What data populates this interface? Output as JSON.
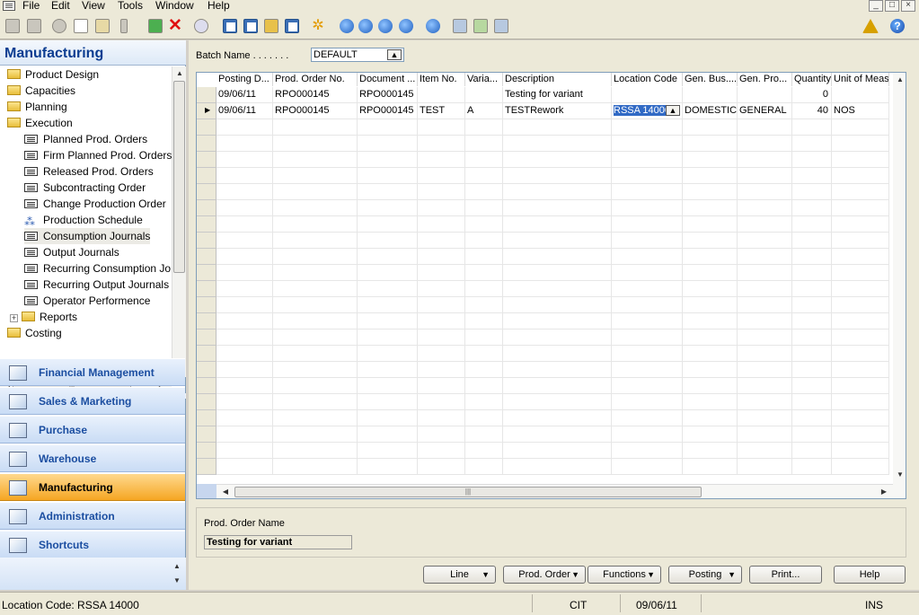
{
  "menu": [
    "File",
    "Edit",
    "View",
    "Tools",
    "Window",
    "Help"
  ],
  "window_controls": [
    "_",
    "□",
    "×"
  ],
  "toolbar_icons": [
    "print-icon",
    "print-preview-icon",
    "cut-icon",
    "copy-icon",
    "paste-icon",
    "attach-icon",
    "delete-icon",
    "find-icon",
    "filter-icon",
    "field-filter-icon",
    "clear-filter-icon",
    "sort-icon",
    "list-icon",
    "flowfield-icon",
    "refresh-icon",
    "first-icon",
    "previous-icon",
    "next-icon",
    "last-icon",
    "up-icon",
    "send-email-icon",
    "export-icon",
    "import-icon",
    "chart-icon",
    "help-icon"
  ],
  "navigation": {
    "title": "Manufacturing",
    "tree": [
      {
        "label": "Product Design",
        "type": "folder",
        "level": 0
      },
      {
        "label": "Capacities",
        "type": "folder",
        "level": 0
      },
      {
        "label": "Planning",
        "type": "folder",
        "level": 0
      },
      {
        "label": "Execution",
        "type": "folder",
        "level": 0
      },
      {
        "label": "Planned Prod. Orders",
        "type": "form",
        "level": 1
      },
      {
        "label": "Firm Planned Prod. Orders",
        "type": "form",
        "level": 1
      },
      {
        "label": "Released Prod. Orders",
        "type": "form",
        "level": 1
      },
      {
        "label": "Subcontracting Order",
        "type": "form",
        "level": 1
      },
      {
        "label": "Change Production Order",
        "type": "form",
        "level": 1
      },
      {
        "label": "Production Schedule",
        "type": "schedule",
        "level": 1
      },
      {
        "label": "Consumption Journals",
        "type": "form",
        "level": 1,
        "selected": true
      },
      {
        "label": "Output Journals",
        "type": "form",
        "level": 1
      },
      {
        "label": "Recurring Consumption Jo",
        "type": "form",
        "level": 1
      },
      {
        "label": "Recurring Output Journals",
        "type": "form",
        "level": 1
      },
      {
        "label": "Operator Performence",
        "type": "form",
        "level": 1
      },
      {
        "label": "Reports",
        "type": "folder",
        "level": 1,
        "expander": "+"
      },
      {
        "label": "Costing",
        "type": "folder",
        "level": 0
      }
    ],
    "buttons": [
      {
        "label": "Financial Management",
        "icon": "financial-management-icon"
      },
      {
        "label": "Sales & Marketing",
        "icon": "sales-marketing-icon"
      },
      {
        "label": "Purchase",
        "icon": "purchase-icon"
      },
      {
        "label": "Warehouse",
        "icon": "warehouse-icon"
      },
      {
        "label": "Manufacturing",
        "icon": "manufacturing-icon",
        "active": true
      },
      {
        "label": "Administration",
        "icon": "administration-icon"
      },
      {
        "label": "Shortcuts",
        "icon": "shortcuts-icon"
      }
    ]
  },
  "journal": {
    "batch_label": "Batch Name . . . . . . .",
    "batch_value": "DEFAULT",
    "columns": [
      "Posting D...",
      "Prod. Order No.",
      "Document ...",
      "Item No.",
      "Varia...",
      "Description",
      "Location Code",
      "Gen. Bus....",
      "Gen. Pro...",
      "Quantity",
      "Unit of Measu"
    ],
    "rows": [
      [
        "09/06/11",
        "RPO000145",
        "RPO000145",
        "",
        "",
        "Testing for variant",
        "",
        "",
        "",
        "0",
        ""
      ],
      [
        "09/06/11",
        "RPO000145",
        "RPO000145",
        "TEST",
        "A",
        "TESTRework",
        "RSSA 14000",
        "DOMESTIC",
        "GENERAL",
        "40",
        "NOS"
      ]
    ],
    "current_row": 1,
    "prod_order_name_label": "Prod. Order Name",
    "prod_order_name_value": "Testing for variant"
  },
  "buttons": {
    "line": "Line",
    "prod_order": "Prod. Order",
    "functions": "Functions",
    "posting": "Posting",
    "print": "Print...",
    "help": "Help"
  },
  "statusbar": {
    "location": "Location Code: RSSA 14000",
    "company": "CIT",
    "work_date": "09/06/11",
    "mode": "INS"
  }
}
